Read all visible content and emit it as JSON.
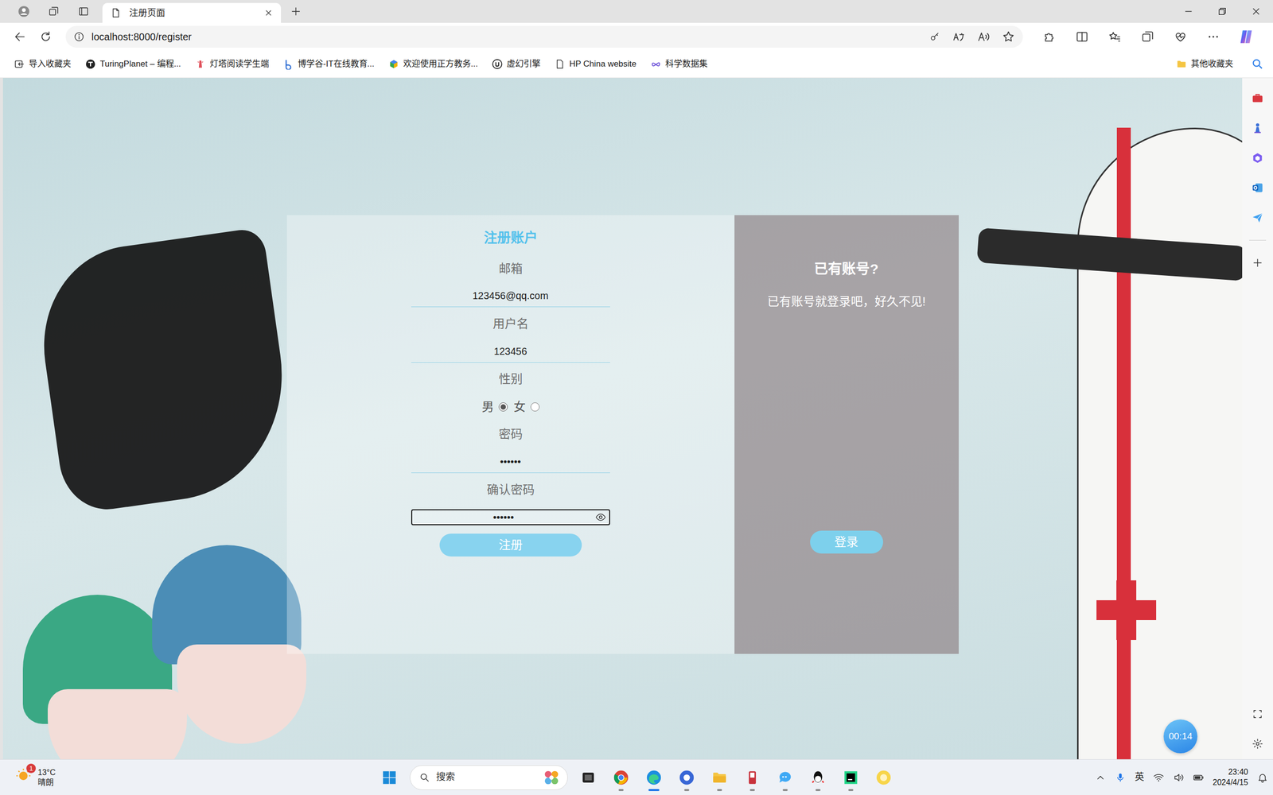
{
  "browser": {
    "tabs": [
      {
        "label": "注册页面",
        "selected": true
      }
    ],
    "address": "localhost:8000/register",
    "bookmarks": [
      {
        "label": "导入收藏夹"
      },
      {
        "label": "TuringPlanet – 编程..."
      },
      {
        "label": "灯塔阅读学生端"
      },
      {
        "label": "博学谷-IT在线教育..."
      },
      {
        "label": "欢迎使用正方教务..."
      },
      {
        "label": "虚幻引擎"
      },
      {
        "label": "HP China website"
      },
      {
        "label": "科学数据集"
      }
    ],
    "other_bookmarks": "其他收藏夹"
  },
  "register": {
    "title": "注册账户",
    "fields": [
      {
        "label": "邮箱",
        "kind": "text",
        "value": "123456@qq.com",
        "focused": false
      },
      {
        "label": "用户名",
        "kind": "text",
        "value": "123456",
        "focused": false
      },
      {
        "label": "性别",
        "kind": "radio",
        "options": [
          {
            "label": "男",
            "selected": true
          },
          {
            "label": "女",
            "selected": false
          }
        ]
      },
      {
        "label": "密码",
        "kind": "password",
        "value": "••••••",
        "focused": false
      },
      {
        "label": "确认密码",
        "kind": "password",
        "value": "••••••",
        "focused": true
      }
    ],
    "submit": "注册"
  },
  "login_panel": {
    "title": "已有账号?",
    "text": "已有账号就登录吧，好久不见!",
    "button": "登录"
  },
  "timer": "00:14",
  "taskbar": {
    "weather_badge": "1",
    "temperature": "13°C",
    "condition": "晴朗",
    "search": "搜索",
    "apps": [
      {
        "running": false,
        "active": false
      },
      {
        "running": true,
        "active": false
      },
      {
        "running": true,
        "active": true
      },
      {
        "running": true,
        "active": false
      },
      {
        "running": true,
        "active": false
      },
      {
        "running": true,
        "active": false
      },
      {
        "running": true,
        "active": false
      },
      {
        "running": true,
        "active": false
      },
      {
        "running": true,
        "active": false
      },
      {
        "running": false,
        "active": false
      }
    ],
    "input_method": "英",
    "time": "23:40",
    "date": "2024/4/15"
  }
}
